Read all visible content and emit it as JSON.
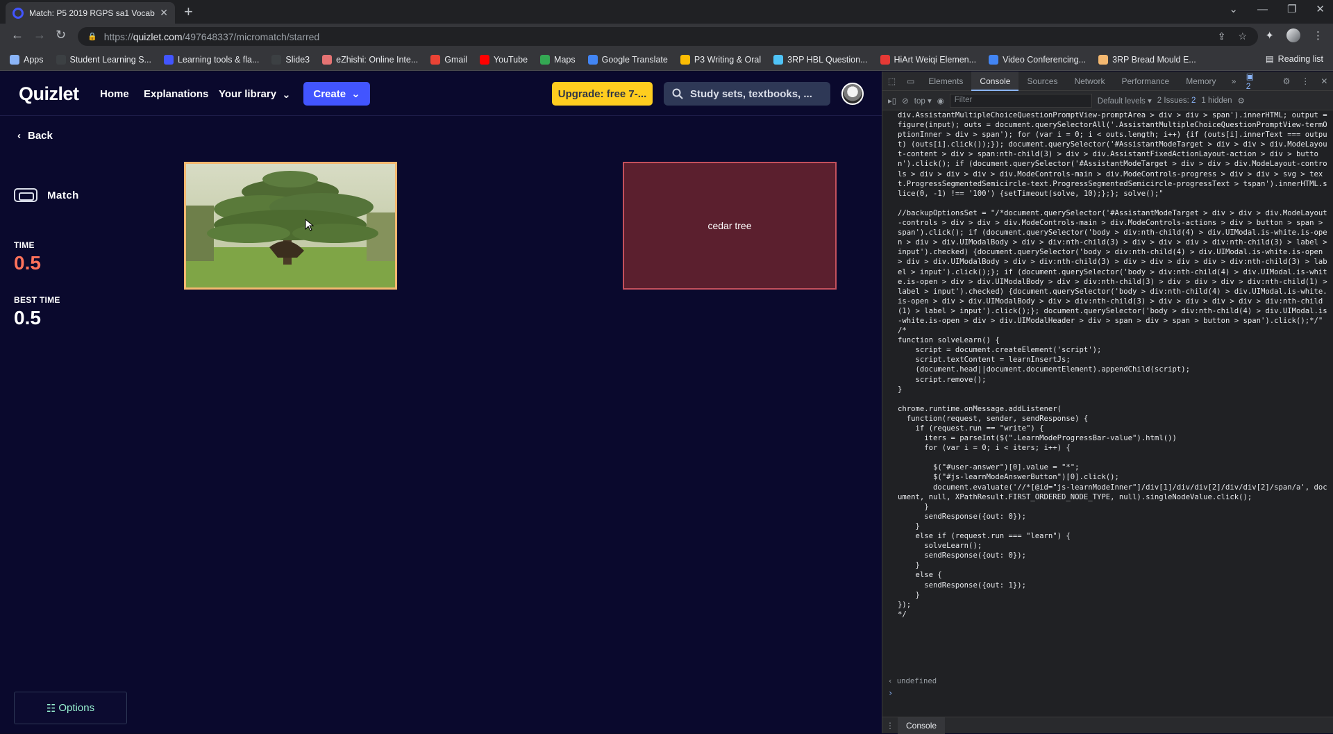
{
  "browser": {
    "tab_title": "Match: P5 2019 RGPS sa1 Vocab",
    "new_tab": "+",
    "url_prefix": "https://",
    "url_host": "quizlet.com",
    "url_path": "/497648337/micromatch/starred",
    "bookmarks": [
      {
        "label": "Apps",
        "color": "#8ab4f8"
      },
      {
        "label": "Student Learning S...",
        "color": "#3c4043"
      },
      {
        "label": "Learning tools & fla...",
        "color": "#4255ff"
      },
      {
        "label": "Slide3",
        "color": "#3c4043"
      },
      {
        "label": "eZhishi: Online Inte...",
        "color": "#e57373"
      },
      {
        "label": "Gmail",
        "color": "#ea4335"
      },
      {
        "label": "YouTube",
        "color": "#ff0000"
      },
      {
        "label": "Maps",
        "color": "#34a853"
      },
      {
        "label": "Google Translate",
        "color": "#4285f4"
      },
      {
        "label": "P3 Writing & Oral",
        "color": "#fbbc04"
      },
      {
        "label": "3RP HBL Question...",
        "color": "#4fc3f7"
      },
      {
        "label": "HiArt Weiqi Elemen...",
        "color": "#e53935"
      },
      {
        "label": "Video Conferencing...",
        "color": "#4285f4"
      },
      {
        "label": "3RP Bread Mould E...",
        "color": "#f4b870"
      }
    ],
    "reading_list": "Reading list"
  },
  "header": {
    "logo": "Quizlet",
    "nav_home": "Home",
    "nav_explanations": "Explanations",
    "nav_library": "Your library",
    "create": "Create",
    "upgrade": "Upgrade: free 7-...",
    "search_placeholder": "Study sets, textbooks, ..."
  },
  "game": {
    "back": "Back",
    "mode": "Match",
    "time_label": "TIME",
    "time_value": "0.5",
    "best_label": "BEST TIME",
    "best_value": "0.5",
    "term_card": "cedar tree",
    "options": "Options",
    "colors": {
      "time": "#ff725b",
      "card_selected": "#5b1f2e",
      "accent": "#4255ff",
      "upgrade": "#ffcd1f"
    }
  },
  "devtools": {
    "tabs": [
      "Elements",
      "Console",
      "Sources",
      "Network",
      "Performance",
      "Memory"
    ],
    "active_tab": "Console",
    "message_badge": "2",
    "context": "top",
    "filter_placeholder": "Filter",
    "levels": "Default levels",
    "issues": "2 Issues:",
    "issues_count": "2",
    "hidden": "1 hidden",
    "console_text": "div.AssistantMultipleChoiceQuestionPromptView-promptArea > div > div > span').innerHTML; output = figure(input); outs = document.querySelectorAll('.AssistantMultipleChoiceQuestionPromptView-termOptionInner > div > span'); for (var i = 0; i < outs.length; i++) {if (outs[i].innerText === output) (outs[i].click());}); document.querySelector('#AssistantModeTarget > div > div > div.ModeLayout-content > div > span:nth-child(3) > div > div.AssistantFixedActionLayout-action > div > button').click(); if (document.querySelector('#AssistantModeTarget > div > div > div.ModeLayout-controls > div > div > div > div.ModeControls-main > div.ModeControls-progress > div > div > svg > text.ProgressSegmentedSemicircle-text.ProgressSegmentedSemicircle-progressText > tspan').innerHTML.slice(0, -1) !== '100') {setTimeout(solve, 10);};}; solve();\"\n\n//backupOptionsSet = \"/*document.querySelector('#AssistantModeTarget > div > div > div.ModeLayout-controls > div > div > div.ModeControls-main > div.ModeControls-actions > div > button > span > span').click(); if (document.querySelector('body > div:nth-child(4) > div.UIModal.is-white.is-open > div > div.UIModalBody > div > div:nth-child(3) > div > div > div > div:nth-child(3) > label > input').checked) {document.querySelector('body > div:nth-child(4) > div.UIModal.is-white.is-open > div > div.UIModalBody > div > div:nth-child(3) > div > div > div > div > div:nth-child(3) > label > input').click();}; if (document.querySelector('body > div:nth-child(4) > div.UIModal.is-white.is-open > div > div.UIModalBody > div > div:nth-child(3) > div > div > div > div:nth-child(1) > label > input').checked) {document.querySelector('body > div:nth-child(4) > div.UIModal.is-white.is-open > div > div.UIModalBody > div > div:nth-child(3) > div > div > div > div > div:nth-child(1) > label > input').click();}; document.querySelector('body > div:nth-child(4) > div.UIModal.is-white.is-open > div > div.UIModalHeader > div > span > div > span > button > span').click();*/\"\n/*\nfunction solveLearn() {\n    script = document.createElement('script');\n    script.textContent = learnInsertJs;\n    (document.head||document.documentElement).appendChild(script);\n    script.remove();\n}\n\nchrome.runtime.onMessage.addListener(\n  function(request, sender, sendResponse) {\n    if (request.run == \"write\") {\n      iters = parseInt($(\".LearnModeProgressBar-value\").html())\n      for (var i = 0; i < iters; i++) {\n\n        $(\"#user-answer\")[0].value = \"*\";\n        $(\"#js-learnModeAnswerButton\")[0].click();\n        document.evaluate('//*[@id=\"js-learnModeInner\"]/div[1]/div/div[2]/div/div[2]/span/a', document, null, XPathResult.FIRST_ORDERED_NODE_TYPE, null).singleNodeValue.click();\n      }\n      sendResponse({out: 0});\n    }\n    else if (request.run === \"learn\") {\n      solveLearn();\n      sendResponse({out: 0});\n    }\n    else {\n      sendResponse({out: 1});\n    }\n});\n*/",
    "result": "undefined",
    "drawer_tab": "Console"
  }
}
